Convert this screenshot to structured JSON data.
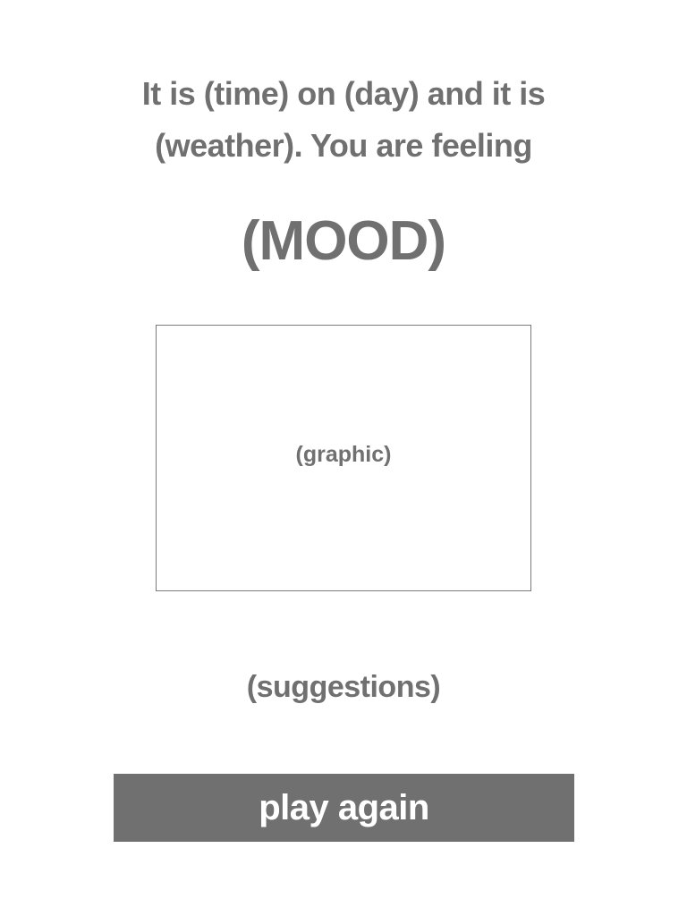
{
  "intro": {
    "line1": "It is (time) on (day) and it is",
    "line2": "(weather). You are feeling"
  },
  "mood": "(MOOD)",
  "graphic": {
    "label": "(graphic)"
  },
  "suggestions": "(suggestions)",
  "play_again_label": "play again",
  "colors": {
    "text": "#707070",
    "button_background": "#707070",
    "button_text": "#ffffff",
    "box_border": "#7a7a7a",
    "background": "#ffffff"
  }
}
